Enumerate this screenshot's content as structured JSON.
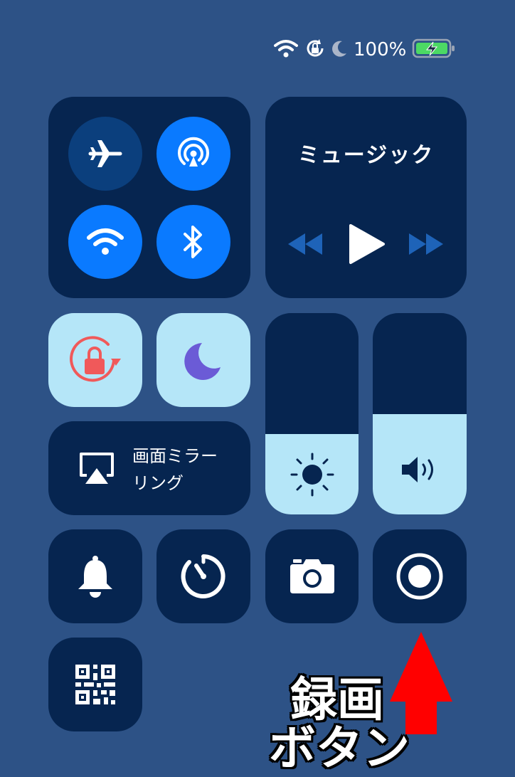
{
  "status_bar": {
    "battery_percent": "100%",
    "icons": [
      "wifi-icon",
      "orientation-lock-icon",
      "moon-icon",
      "battery-charging-icon"
    ]
  },
  "connectivity": {
    "airplane": {
      "icon": "airplane-icon",
      "active": false
    },
    "airdrop": {
      "icon": "airdrop-icon",
      "active": true
    },
    "wifi": {
      "icon": "wifi-icon",
      "active": true
    },
    "bluetooth": {
      "icon": "bluetooth-icon",
      "active": true
    }
  },
  "music": {
    "title": "ミュージック",
    "controls": [
      "rewind-icon",
      "play-icon",
      "fast-forward-icon"
    ]
  },
  "toggles": {
    "orientation_lock": {
      "icon": "orientation-lock-icon",
      "active": true
    },
    "do_not_disturb": {
      "icon": "moon-icon",
      "active": true
    }
  },
  "screen_mirroring": {
    "label_line1": "画面ミラー",
    "label_line2": "リング"
  },
  "sliders": {
    "brightness": {
      "icon": "sun-icon",
      "level": 0.4
    },
    "volume": {
      "icon": "speaker-icon",
      "level": 0.5
    }
  },
  "bottom_row": [
    "bell-icon",
    "timer-icon",
    "camera-icon",
    "screen-record-icon"
  ],
  "extra": [
    "qr-code-icon"
  ],
  "annotation": {
    "line1": "録画",
    "line2": "ボタン",
    "arrow_color": "#ff0000"
  },
  "colors": {
    "background": "#2d5286",
    "tile": "#062550",
    "accent": "#0a7aff",
    "light_tile": "#b5e6f8",
    "lock_red": "#f0595a",
    "moon_purple": "#6b5bd6"
  }
}
